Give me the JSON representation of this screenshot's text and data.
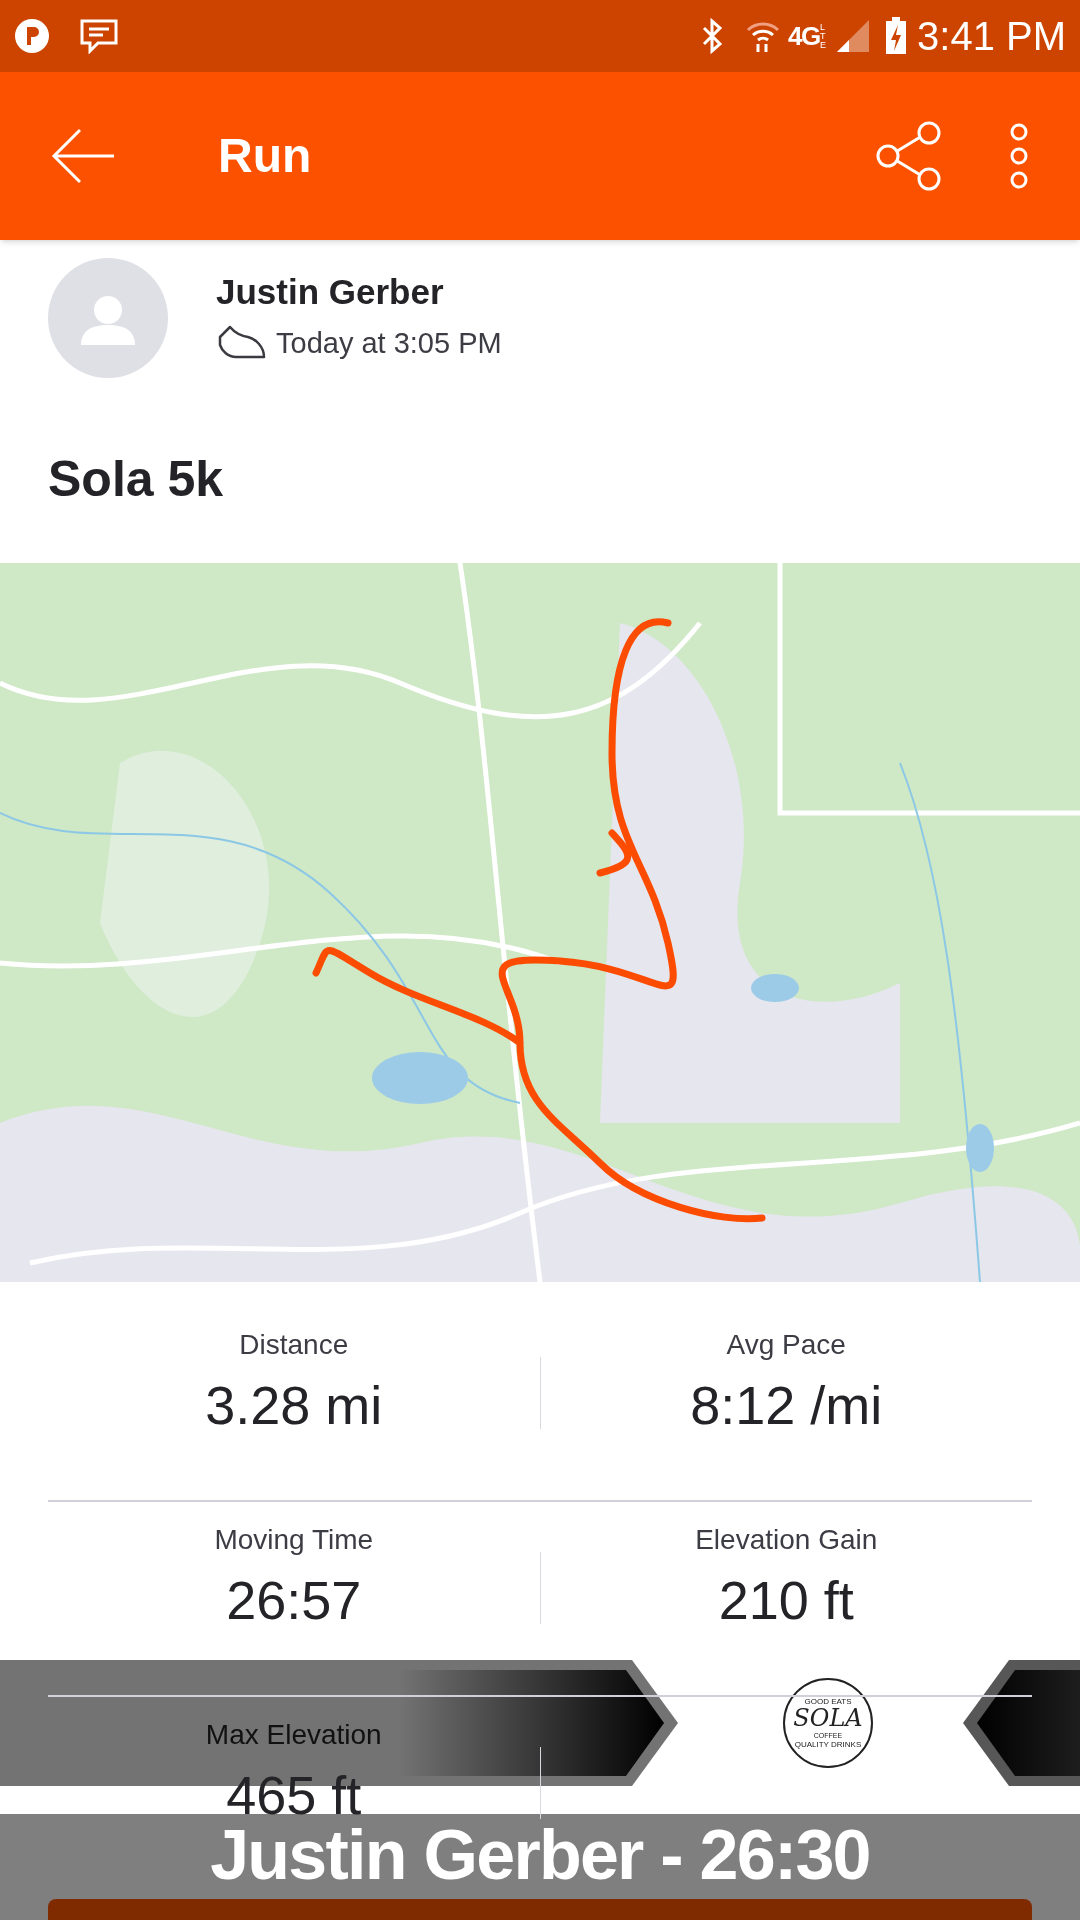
{
  "status_bar": {
    "network": "4G",
    "network_sub": "LTE",
    "time": "3:41 PM"
  },
  "app_bar": {
    "title": "Run"
  },
  "activity": {
    "athlete": "Justin Gerber",
    "time": "Today at 3:05 PM",
    "title": "Sola 5k"
  },
  "stats": [
    {
      "label": "Distance",
      "value": "3.28 mi"
    },
    {
      "label": "Avg Pace",
      "value": "8:12 /mi"
    },
    {
      "label": "Moving Time",
      "value": "26:57"
    },
    {
      "label": "Elevation Gain",
      "value": "210 ft"
    },
    {
      "label": "Max Elevation",
      "value": "465 ft"
    }
  ],
  "overlay": {
    "logo": {
      "top": "GOOD EATS",
      "name": "SOLA",
      "sub": "COFFEE",
      "bottom": "QUALITY DRINKS"
    },
    "caption": "Justin Gerber - 26:30"
  }
}
